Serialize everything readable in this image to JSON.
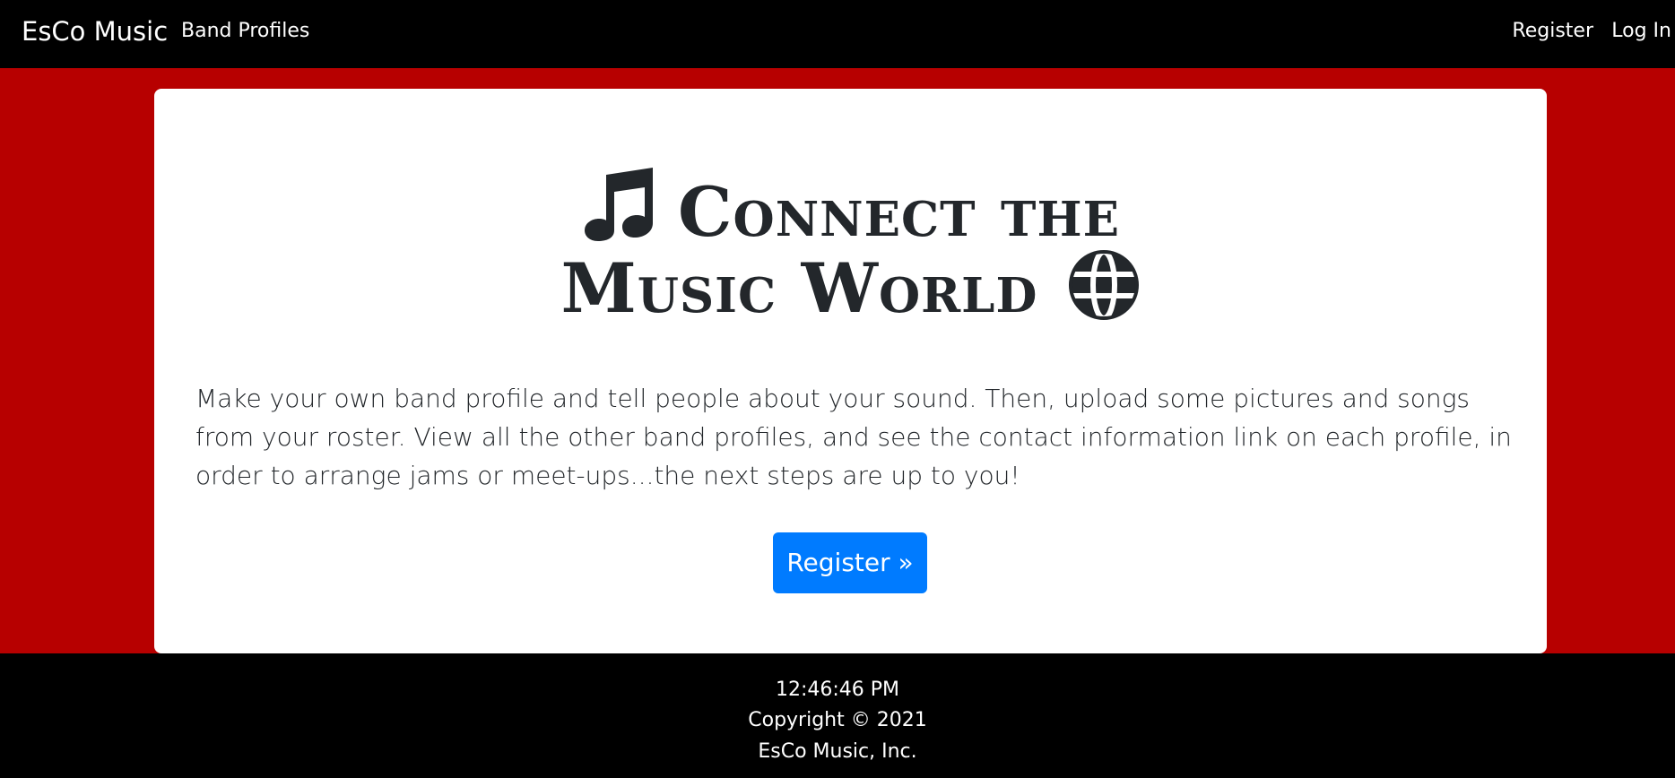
{
  "navbar": {
    "brand": "EsCo Music",
    "band_profiles": "Band Profiles",
    "register": "Register",
    "login": "Log In"
  },
  "hero": {
    "title_line1": "Connect the",
    "title_line2": "Music World",
    "icons": [
      "music-note-icon",
      "globe-icon"
    ],
    "description": "Make your own band profile and tell people about your sound. Then, upload some pictures and songs from your roster. View all the other band profiles, and see the contact information link on each profile, in order to arrange jams or meet-ups...the next steps are up to you!",
    "register_button": "Register »"
  },
  "footer": {
    "time": "12:46:46 PM",
    "copyright": "Copyright © 2021",
    "company": "EsCo Music, Inc."
  },
  "colors": {
    "page_background": "#b70000",
    "navbar_background": "#000000",
    "button_primary": "#007bff",
    "heading_text": "#23272b"
  }
}
